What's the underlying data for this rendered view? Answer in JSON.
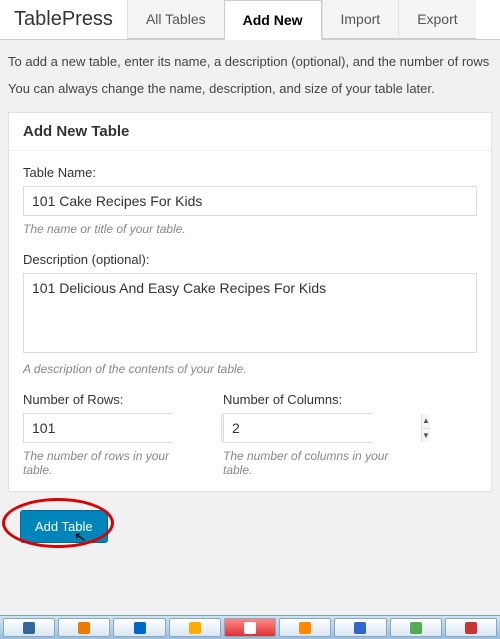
{
  "brand": "TablePress",
  "tabs": [
    {
      "label": "All Tables"
    },
    {
      "label": "Add New"
    },
    {
      "label": "Import"
    },
    {
      "label": "Export"
    }
  ],
  "intro": {
    "line1": "To add a new table, enter its name, a description (optional), and the number of rows and columns.",
    "line2": "You can always change the name, description, and size of your table later."
  },
  "panel": {
    "title": "Add New Table",
    "table_name": {
      "label": "Table Name:",
      "value": "101 Cake Recipes For Kids",
      "hint": "The name or title of your table."
    },
    "description": {
      "label": "Description (optional):",
      "value": "101 Delicious And Easy Cake Recipes For Kids",
      "hint": "A description of the contents of your table."
    },
    "rows": {
      "label": "Number of Rows:",
      "value": "101",
      "hint": "The number of rows in your table."
    },
    "columns": {
      "label": "Number of Columns:",
      "value": "2",
      "hint": "The number of columns in your table."
    }
  },
  "footer": {
    "add_button": "Add Table"
  }
}
